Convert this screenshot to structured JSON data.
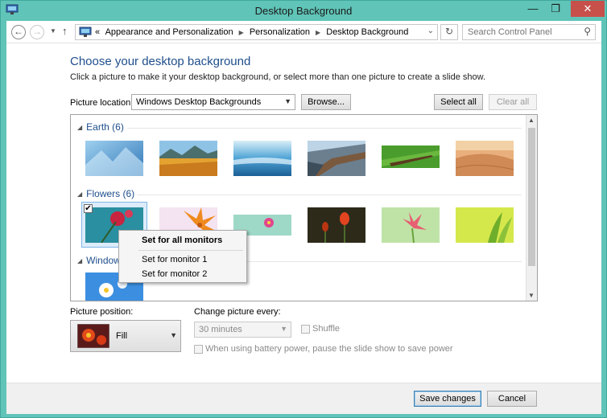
{
  "window": {
    "title": "Desktop Background",
    "close_glyph": "✕",
    "min_glyph": "—",
    "max_glyph": "❐"
  },
  "nav": {
    "breadcrumb_prefix": "«",
    "breadcrumbs": [
      "Appearance and Personalization",
      "Personalization",
      "Desktop Background"
    ],
    "search_placeholder": "Search Control Panel"
  },
  "main": {
    "heading": "Choose your desktop background",
    "subheading": "Click a picture to make it your desktop background, or select more than one picture to create a slide show.",
    "picture_location_label": "Picture location:",
    "picture_location_value": "Windows Desktop Backgrounds",
    "browse_label": "Browse...",
    "select_all_label": "Select all",
    "clear_all_label": "Clear all"
  },
  "groups": [
    {
      "label": "Earth (6)"
    },
    {
      "label": "Flowers (6)"
    },
    {
      "label": "Windows (1)"
    }
  ],
  "context_menu": {
    "items": [
      "Set for all monitors",
      "Set for monitor 1",
      "Set for monitor 2"
    ]
  },
  "options": {
    "picture_position_label": "Picture position:",
    "picture_position_value": "Fill",
    "change_every_label": "Change picture every:",
    "interval_value": "30 minutes",
    "shuffle_label": "Shuffle",
    "battery_label": "When using battery power, pause the slide show to save power"
  },
  "footer": {
    "save_label": "Save changes",
    "cancel_label": "Cancel"
  },
  "colors": {
    "frame": "#60c4b8",
    "heading": "#1e4e8c",
    "close": "#c7504b"
  }
}
